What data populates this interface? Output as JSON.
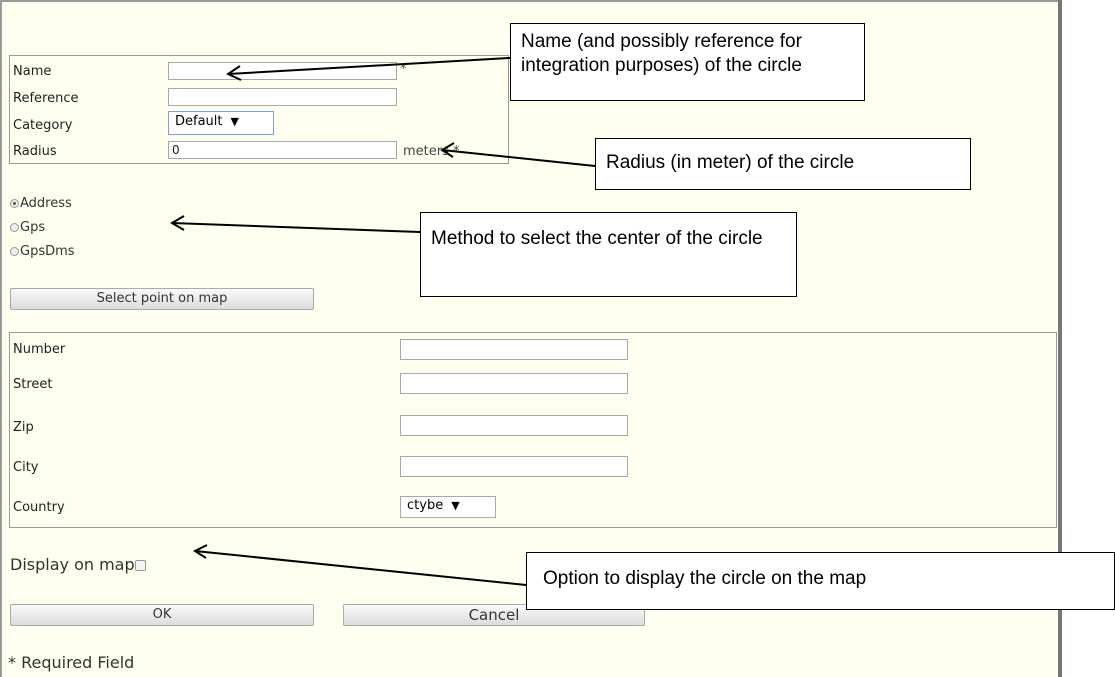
{
  "fields": {
    "name_label": "Name",
    "reference_label": "Reference",
    "category_label": "Category",
    "category_value": "Default",
    "radius_label": "Radius",
    "radius_value": "0",
    "radius_unit": "meters *",
    "required_marker": "*"
  },
  "method": {
    "options": [
      "Address",
      "Gps",
      "GpsDms"
    ],
    "selected": "Address",
    "select_point_button": "Select point on map"
  },
  "address": {
    "number_label": "Number",
    "street_label": "Street",
    "zip_label": "Zip",
    "city_label": "City",
    "country_label": "Country",
    "country_value": "ctybe"
  },
  "display": {
    "label": "Display on map",
    "checked": false
  },
  "buttons": {
    "ok": "OK",
    "cancel": "Cancel"
  },
  "footer": {
    "required_note": "* Required Field"
  },
  "callouts": {
    "name": "Name (and possibly reference for integration purposes) of the circle",
    "radius": "Radius (in meter) of the circle",
    "method": "Method to select the center of the circle",
    "display": "Option to display the circle on the map"
  }
}
